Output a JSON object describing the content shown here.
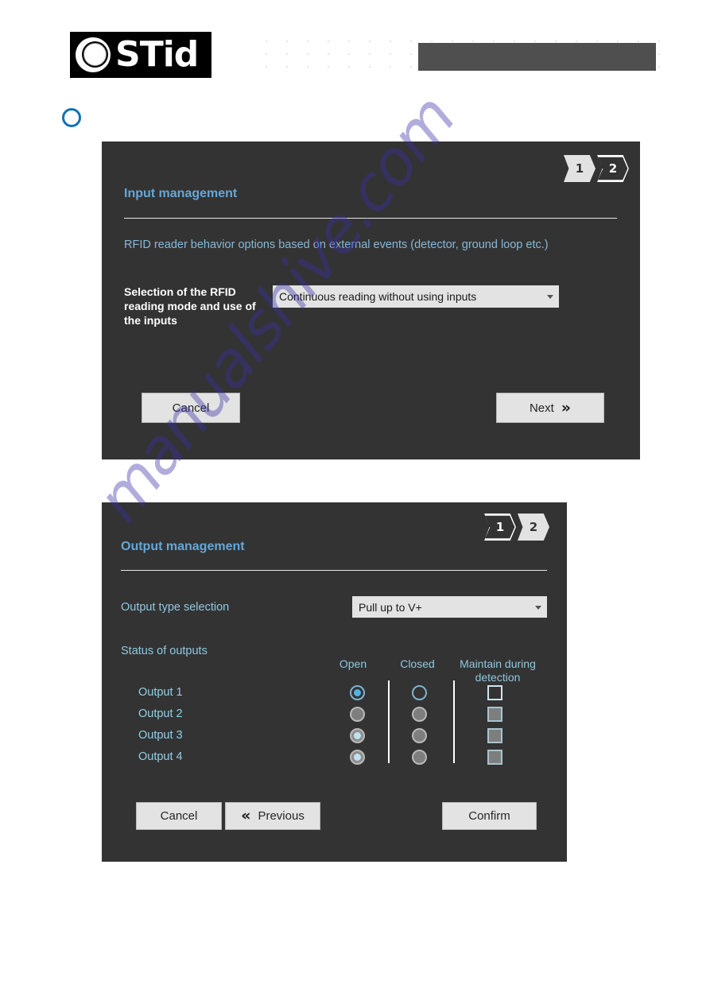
{
  "document": {
    "logo": {
      "text": "STid",
      "mark": "stid-lens-logo"
    },
    "header_bar": {
      "color": "#4f4f4f"
    },
    "bullet_marker": {
      "shape": "circle-outline",
      "color": "#0f72b5"
    },
    "watermark": {
      "text": "manualshive.com",
      "color": "#3a32a8"
    }
  },
  "panels": [
    {
      "id": "input-management",
      "title": "Input management",
      "subtitle": "RFID reader behavior options based on external events (detector, ground loop etc.)",
      "steps": [
        {
          "label": "1",
          "state": "active"
        },
        {
          "label": "2",
          "state": "inactive"
        }
      ],
      "field": {
        "label": "Selection of the RFID reading mode and use of the inputs",
        "dropdown_value": "Continuous reading without using inputs",
        "caret": "chevron-down-icon"
      },
      "buttons": {
        "cancel": "Cancel",
        "next": "Next",
        "next_icon": "»"
      }
    },
    {
      "id": "output-management",
      "title": "Output management",
      "steps": [
        {
          "label": "1",
          "state": "inactive"
        },
        {
          "label": "2",
          "state": "active"
        }
      ],
      "type_selection": {
        "label": "Output type selection",
        "dropdown_value": "Pull up to V+",
        "caret": "chevron-down-icon"
      },
      "status": {
        "section_label": "Status of outputs",
        "columns": [
          "Open",
          "Closed",
          "Maintain during detection"
        ],
        "rows": [
          {
            "label": "Output 1",
            "open": "selected-enabled",
            "closed": "unselected-enabled",
            "maintain": "unchecked-enabled"
          },
          {
            "label": "Output 2",
            "open": "unselected-disabled",
            "closed": "unselected-disabled",
            "maintain": "unchecked-disabled"
          },
          {
            "label": "Output 3",
            "open": "selected-disabled",
            "closed": "unselected-disabled",
            "maintain": "unchecked-disabled"
          },
          {
            "label": "Output 4",
            "open": "selected-disabled",
            "closed": "unselected-disabled",
            "maintain": "unchecked-disabled"
          }
        ]
      },
      "buttons": {
        "cancel": "Cancel",
        "previous": "Previous",
        "previous_icon": "«",
        "confirm": "Confirm"
      }
    }
  ]
}
